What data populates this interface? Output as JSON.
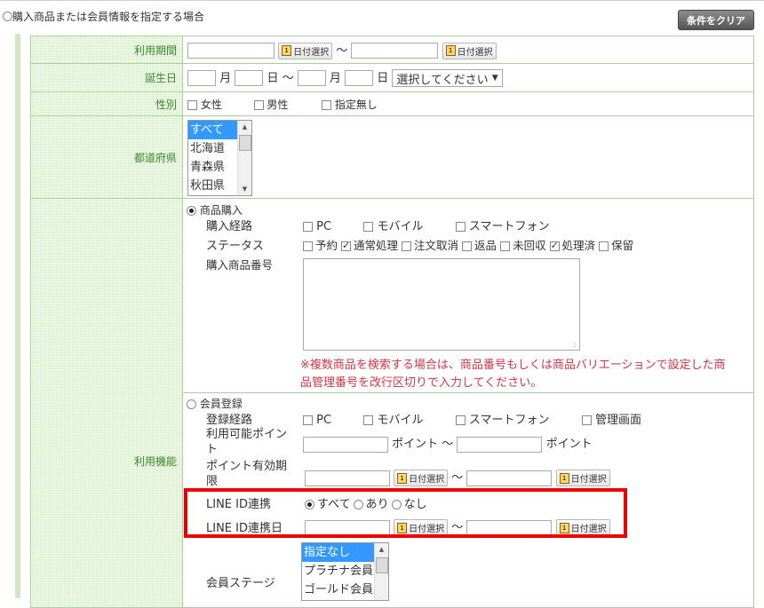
{
  "header": {
    "radio_label": "購入商品または会員情報を指定する場合",
    "clear_button": "条件をクリア"
  },
  "common": {
    "tilde": "～",
    "date_button": "日付選択",
    "calendar_glyph": "1"
  },
  "usage_period": {
    "label": "利用期間"
  },
  "birthday": {
    "label": "誕生日",
    "month": "月",
    "day": "日",
    "select_value": "選択してください"
  },
  "gender": {
    "label": "性別",
    "options": [
      "女性",
      "男性",
      "指定無し"
    ]
  },
  "prefecture": {
    "label": "都道府県",
    "options": [
      "すべて",
      "北海道",
      "青森県",
      "秋田県"
    ],
    "selected": "すべて"
  },
  "usage_function": {
    "label": "利用機能",
    "purchase": {
      "radio_label": "商品購入",
      "route_label": "購入経路",
      "routes": [
        "PC",
        "モバイル",
        "スマートフォン"
      ],
      "status_label": "ステータス",
      "statuses": [
        {
          "label": "予約",
          "checked": false
        },
        {
          "label": "通常処理",
          "checked": true
        },
        {
          "label": "注文取消",
          "checked": false
        },
        {
          "label": "返品",
          "checked": false
        },
        {
          "label": "未回収",
          "checked": false
        },
        {
          "label": "処理済",
          "checked": true
        },
        {
          "label": "保留",
          "checked": false
        }
      ],
      "product_number_label": "購入商品番号",
      "note_line1": "※複数商品を検索する場合は、商品番号もしくは商品バリエーションで設定した商",
      "note_line2": "品管理番号を改行区切りで入力してください。"
    },
    "member": {
      "radio_label": "会員登録",
      "route_label": "登録経路",
      "routes": [
        "PC",
        "モバイル",
        "スマートフォン",
        "管理画面"
      ],
      "points_label_1": "利用可能ポイン",
      "points_label_2": "ト",
      "point_unit": "ポイント",
      "point_expiry_label_1": "ポイント有効期",
      "point_expiry_label_2": "限",
      "line_label": "LINE ID連携",
      "line_options": [
        {
          "label": "すべて",
          "checked": true
        },
        {
          "label": "あり",
          "checked": false
        },
        {
          "label": "なし",
          "checked": false
        }
      ],
      "line_date_label": "LINE ID連携日",
      "stage_label": "会員ステージ",
      "stage_options": [
        "指定なし",
        "プラチナ会員",
        "ゴールド会員"
      ],
      "stage_selected": "指定なし"
    }
  }
}
